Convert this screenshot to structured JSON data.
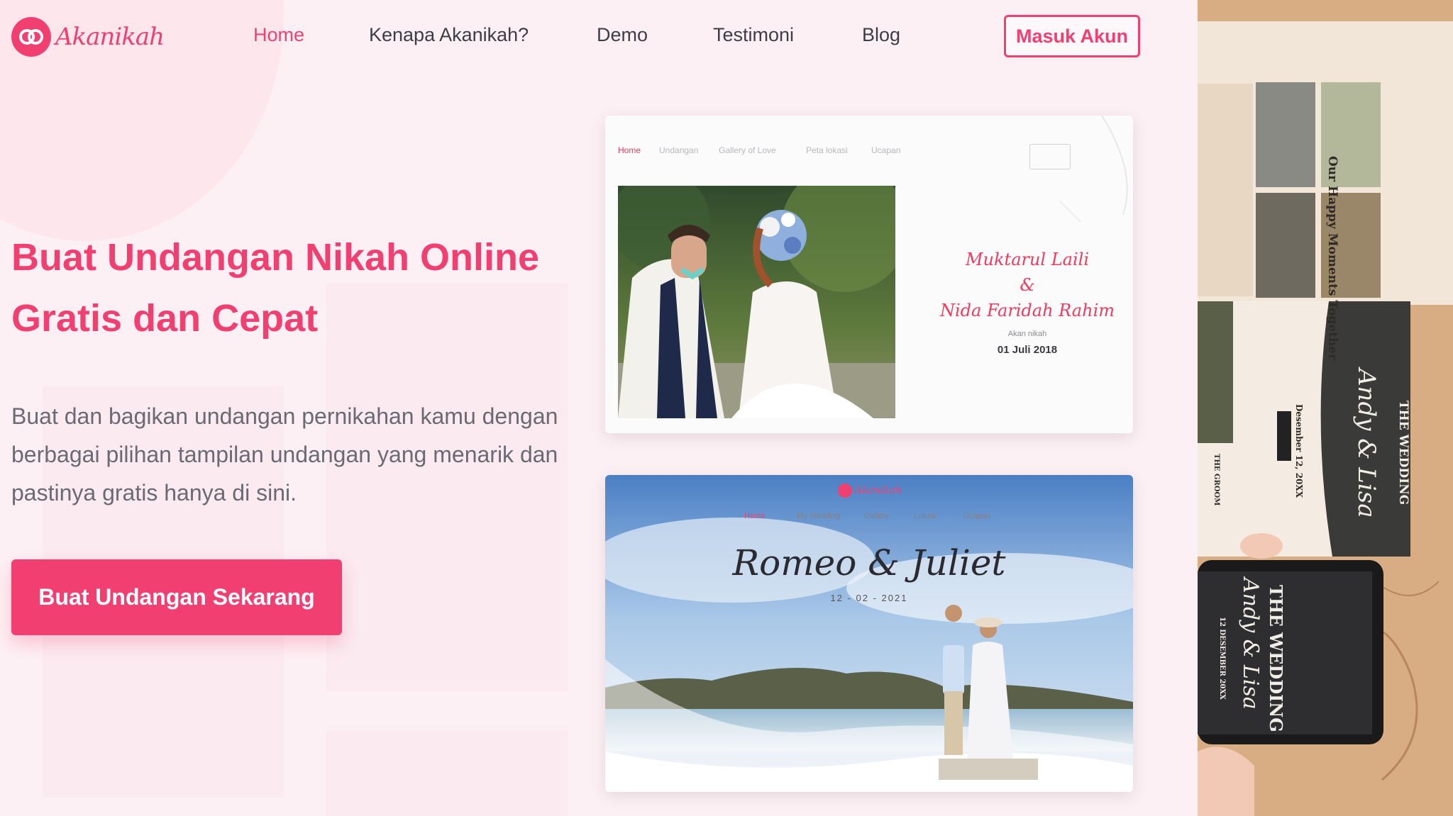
{
  "brand": {
    "name": "Akanikah",
    "accent": "#f23f72"
  },
  "nav": {
    "items": [
      {
        "label": "Home",
        "active": true
      },
      {
        "label": "Kenapa Akanikah?",
        "active": false
      },
      {
        "label": "Demo",
        "active": false
      },
      {
        "label": "Testimoni",
        "active": false
      },
      {
        "label": "Blog",
        "active": false
      }
    ],
    "login_label": "Masuk Akun"
  },
  "hero": {
    "title_line1": "Buat Undangan Nikah Online",
    "title_line2": "Gratis dan Cepat",
    "desc_line1": "Buat dan bagikan undangan pernikahan kamu dengan",
    "desc_line2": "berbagai pilihan tampilan undangan yang menarik dan",
    "desc_line3": "pastinya gratis hanya di sini.",
    "cta_label": "Buat Undangan Sekarang"
  },
  "preview1": {
    "nav": [
      "Home",
      "Undangan",
      "Gallery of Love",
      "Peta lokasi",
      "Ucapan"
    ],
    "name1": "Muktarul Laili",
    "amp": "&",
    "name2": "Nida Faridah Rahim",
    "small": "Akan nikah",
    "date": "01 Juli 2018"
  },
  "preview2": {
    "brand": "Akanikah",
    "nav": [
      "Home",
      "My Wedding",
      "Gallery",
      "Lokasi",
      "Ucapan"
    ],
    "title": "Romeo & Juliet",
    "date": "12 - 02 - 2021"
  },
  "side": {
    "moments": "Our Happy Moments Together",
    "date": "Desember 12, 20XX",
    "wedding": "THE WEDDING",
    "couple": "Andy & Lisa",
    "groom": "THE GROOM",
    "phone_date": "12 DESEMBER 20XX"
  }
}
